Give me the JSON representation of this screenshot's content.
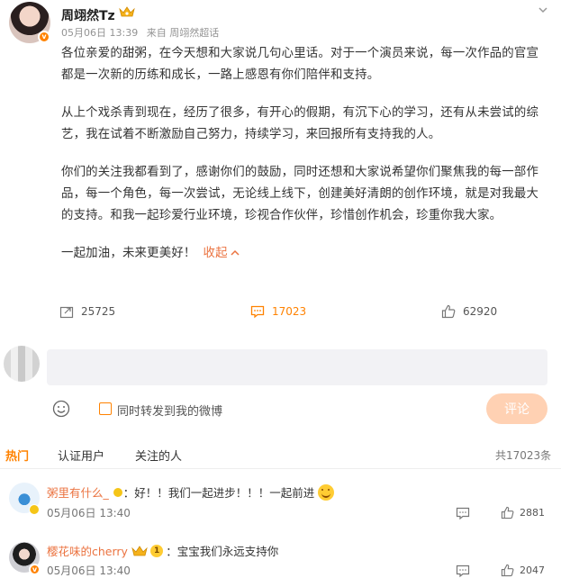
{
  "post": {
    "author": "周翊然Tz",
    "date": "05月06日 13:39",
    "source": "来自 周翊然超话",
    "verified_badge": "v",
    "paragraphs": [
      "各位亲爱的甜粥，在今天想和大家说几句心里话。对于一个演员来说，每一次作品的官宣都是一次新的历练和成长，一路上感恩有你们陪伴和支持。",
      "从上个戏杀青到现在，经历了很多，有开心的假期，有沉下心的学习，还有从未尝试的综艺，我在试着不断激励自己努力，持续学习，来回报所有支持我的人。",
      "你们的关注我都看到了，感谢你们的鼓励，同时还想和大家说希望你们聚焦我的每一部作品，每一个角色，每一次尝试，无论线上线下，创建美好清朗的创作环境，就是对我最大的支持。和我一起珍爱行业环境，珍视合作伙伴，珍惜创作机会，珍重你我大家。"
    ],
    "closing": "一起加油，未来更美好！",
    "collapse_label": "收起",
    "reposts": "25725",
    "comments": "17023",
    "likes": "62920"
  },
  "composer": {
    "input_value": "",
    "repost_label": "同时转发到我的微博",
    "submit_label": "评论"
  },
  "tabs": [
    {
      "label": "热门"
    },
    {
      "label": "认证用户"
    },
    {
      "label": "关注的人"
    }
  ],
  "comment_total": "共17023条",
  "comments": [
    {
      "user": "粥里有什么_",
      "text": "：好！！我们一起进步！！！一起前进",
      "time": "05月06日 13:40",
      "likes": "2881"
    },
    {
      "user": "樱花味的cherry",
      "level": "1",
      "text": "：宝宝我们永远支持你",
      "time": "05月06日 13:40",
      "likes": "2047"
    }
  ],
  "colors": {
    "accent": "#ff8200",
    "link": "#eb7340",
    "button_disabled": "#ffd1b3"
  }
}
